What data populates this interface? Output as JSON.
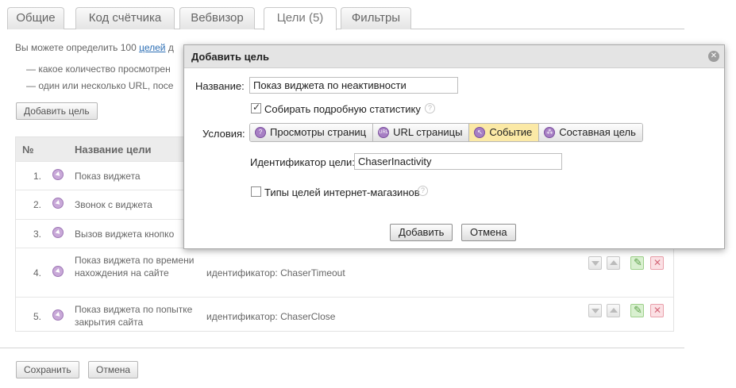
{
  "tabs": [
    {
      "label": "Общие"
    },
    {
      "label": "Код счётчика"
    },
    {
      "label": "Вебвизор"
    },
    {
      "label": "Цели (5)",
      "active": true
    },
    {
      "label": "Фильтры"
    }
  ],
  "intro": {
    "prefix": "Вы можете определить 100",
    "link": "целей",
    "suffix": "д",
    "bullet_1": "— какое количество просмотрен",
    "bullet_2": "— один или несколько URL, посе"
  },
  "add_goal_button": "Добавить цель",
  "table": {
    "col_num": "№",
    "col_name": "Название цели",
    "rows": [
      {
        "num": "1.",
        "name": "Показ виджета",
        "condition": ""
      },
      {
        "num": "2.",
        "name": "Звонок с виджета",
        "condition": ""
      },
      {
        "num": "3.",
        "name": "Вызов виджета кнопко",
        "condition": ""
      },
      {
        "num": "4.",
        "name": "Показ виджета по времени нахождения на сайте",
        "condition": "идентификатор: ChaserTimeout"
      },
      {
        "num": "5.",
        "name": "Показ виджета по попытке закрытия сайта",
        "condition": "идентификатор: ChaserClose"
      }
    ]
  },
  "footer": {
    "save": "Сохранить",
    "cancel": "Отмена"
  },
  "dialog": {
    "title": "Добавить цель",
    "close_icon": "close-icon",
    "name_label": "Название:",
    "name_value": "Показ виджета по неактивности",
    "collect_stats_label": "Собирать подробную статистику",
    "collect_stats_checked": true,
    "conditions_label": "Условия:",
    "condition_types": [
      {
        "label": "Просмотры страниц",
        "icon": "pageviews-icon",
        "glyph": "?"
      },
      {
        "label": "URL страницы",
        "icon": "url-icon",
        "glyph": "URL"
      },
      {
        "label": "Событие",
        "icon": "event-icon",
        "glyph": "↖",
        "active": true
      },
      {
        "label": "Составная цель",
        "icon": "composite-goal-icon",
        "glyph": "⁂"
      }
    ],
    "goal_id_label": "Идентификатор цели:",
    "goal_id_value": "ChaserInactivity",
    "shop_types_label": "Типы целей интернет-магазинов",
    "shop_types_checked": false,
    "add_button": "Добавить",
    "cancel_button": "Отмена"
  },
  "colors": {
    "active_condition": "#fbe9a6",
    "goal_icon": "#a77fc4",
    "edit": "#d9f0d0",
    "delete": "#fbe0e4"
  }
}
